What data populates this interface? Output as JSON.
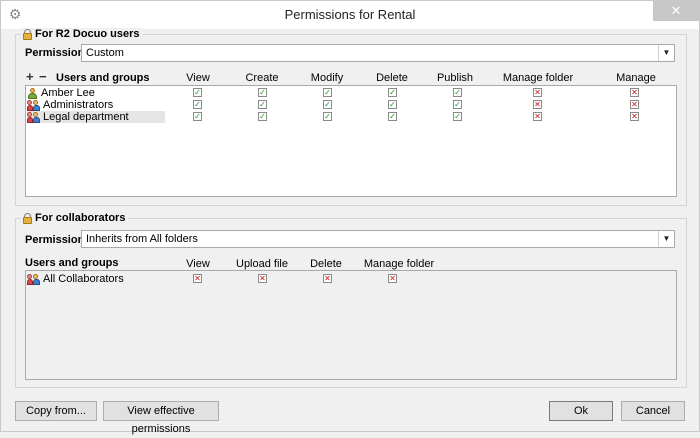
{
  "window": {
    "title": "Permissions for Rental",
    "close_glyph": "✕"
  },
  "r2": {
    "group_title": "For R2 Docuo users",
    "permissions_label": "Permissions:",
    "permissions_value": "Custom",
    "headers": {
      "users_groups": "Users and groups",
      "view": "View",
      "create": "Create",
      "modify": "Modify",
      "delete": "Delete",
      "publish": "Publish",
      "manage_folder": "Manage folder",
      "manage_permissions": "Manage permissions"
    },
    "rows": [
      {
        "name": "Amber Lee",
        "icon": "user-icon"
      },
      {
        "name": "Administrators",
        "icon": "group-icon"
      },
      {
        "name": "Legal department",
        "icon": "group-icon"
      }
    ]
  },
  "collab": {
    "group_title": "For collaborators",
    "permissions_label": "Permissions:",
    "permissions_value": "Inherits from All folders",
    "headers": {
      "users_groups": "Users and groups",
      "view": "View",
      "upload_file": "Upload file",
      "delete": "Delete",
      "manage_folder": "Manage folder"
    },
    "rows": [
      {
        "name": "All Collaborators",
        "icon": "group-icon"
      }
    ]
  },
  "buttons": {
    "copy_from": "Copy from...",
    "view_effective": "View effective permissions",
    "ok": "Ok",
    "cancel": "Cancel"
  },
  "glyphs": {
    "check": "✓",
    "cross": "✕",
    "plus": "+",
    "minus": "−",
    "dropdown": "▼",
    "gear": "⚙"
  },
  "colors": {
    "check": "#1a9a1a",
    "cross": "#d01010"
  }
}
